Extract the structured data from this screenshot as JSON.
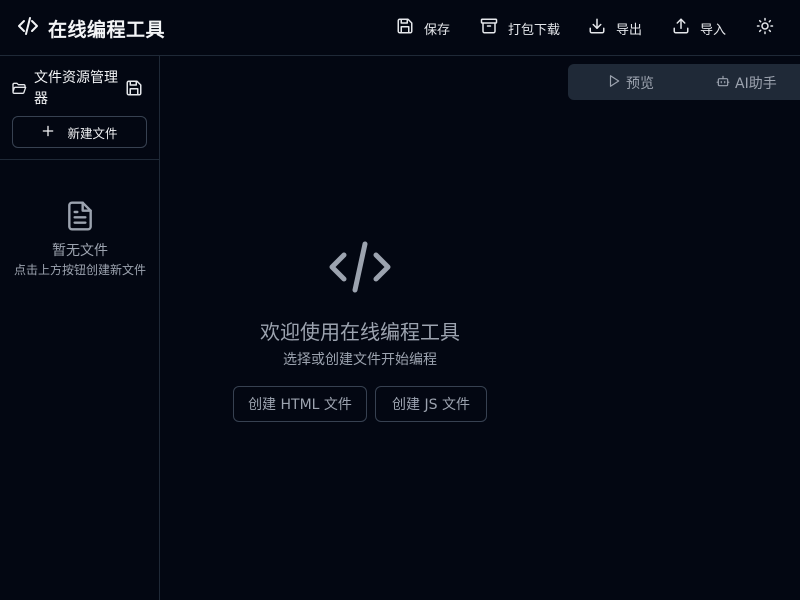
{
  "header": {
    "title": "在线编程工具",
    "logo_icon": "code-icon",
    "toolbar": {
      "save": "保存",
      "pack_download": "打包下载",
      "export": "导出",
      "import": "导入",
      "theme_icon": "sun-icon"
    }
  },
  "sidebar": {
    "title": "文件资源管理器",
    "new_file_label": "新建文件",
    "empty": {
      "title": "暂无文件",
      "subtitle": "点击上方按钮创建新文件"
    }
  },
  "right_tabs": {
    "preview": "预览",
    "ai": "AI助手"
  },
  "welcome": {
    "title": "欢迎使用在线编程工具",
    "subtitle": "选择或创建文件开始编程",
    "create_html": "创建 HTML 文件",
    "create_js": "创建 JS 文件"
  },
  "colors": {
    "background": "#030712",
    "border": "#1f2937",
    "muted_text": "#9ca3af",
    "text": "#e5e7eb"
  }
}
